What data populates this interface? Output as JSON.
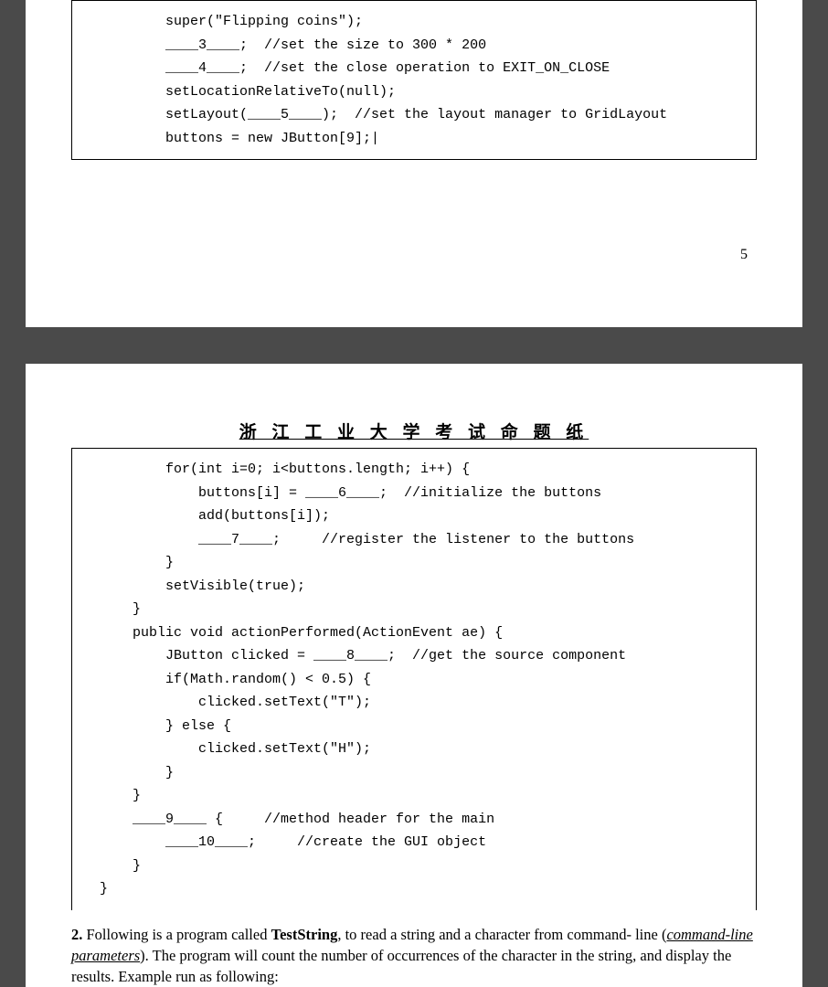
{
  "page1": {
    "code_lines": [
      "        super(\"Flipping coins\");",
      "        ____3____;  //set the size to 300 * 200",
      "        ____4____;  //set the close operation to EXIT_ON_CLOSE",
      "        setLocationRelativeTo(null);",
      "        setLayout(____5____);  //set the layout manager to GridLayout",
      "",
      "        buttons = new JButton[9];|"
    ],
    "page_number": "5"
  },
  "page2": {
    "header": "浙 江 工 业 大 学 考 试 命 题 纸",
    "code_lines": [
      "        for(int i=0; i<buttons.length; i++) {",
      "            buttons[i] = ____6____;  //initialize the buttons",
      "            add(buttons[i]);",
      "            ____7____;     //register the listener to the buttons",
      "        }",
      "",
      "        setVisible(true);",
      "    }",
      "    public void actionPerformed(ActionEvent ae) {",
      "        JButton clicked = ____8____;  //get the source component",
      "        if(Math.random() < 0.5) {",
      "            clicked.setText(\"T\");",
      "        } else {",
      "            clicked.setText(\"H\");",
      "        }",
      "    }",
      "    ____9____ {     //method header for the main",
      "        ____10____;     //create the GUI object",
      "    }",
      "}"
    ],
    "question2": {
      "number": "2.",
      "intro": " Following is a program called ",
      "program_name": "TestString",
      "cont1": ", to read a string and a character from command- line (",
      "param_text": "command-line parameters",
      "cont2": "). The program will count the number of occurrences of the character in the string, and display the results. Example run as following:"
    }
  }
}
